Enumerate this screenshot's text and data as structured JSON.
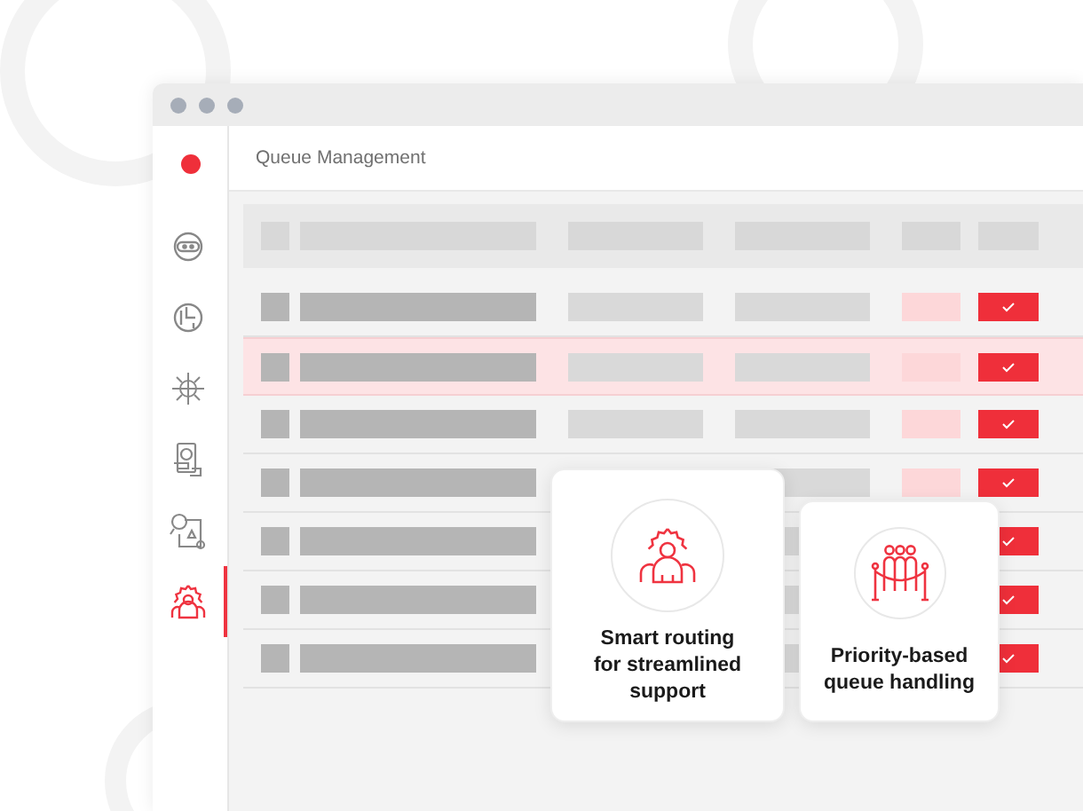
{
  "window": {
    "title": "Queue Management"
  },
  "sidebar": {
    "items": [
      {
        "selected": false
      },
      {
        "selected": false
      },
      {
        "selected": false
      },
      {
        "selected": false
      },
      {
        "selected": false
      },
      {
        "selected": true
      }
    ]
  },
  "table": {
    "rows": [
      {
        "highlighted": false,
        "checked": true
      },
      {
        "highlighted": true,
        "checked": true
      },
      {
        "highlighted": false,
        "checked": true
      },
      {
        "highlighted": false,
        "checked": true
      },
      {
        "highlighted": false,
        "checked": true
      },
      {
        "highlighted": false,
        "checked": true
      },
      {
        "highlighted": false,
        "checked": true
      }
    ]
  },
  "cards": [
    {
      "text": "Smart routing for streamlined support"
    },
    {
      "text": "Priority-based queue handling"
    }
  ]
}
